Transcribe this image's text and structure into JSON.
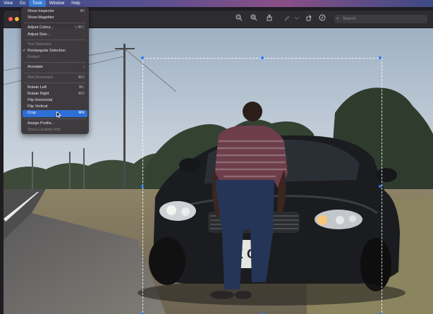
{
  "menubar": {
    "items": [
      {
        "label": "View",
        "active": false
      },
      {
        "label": "Go",
        "active": false
      },
      {
        "label": "Tools",
        "active": true
      },
      {
        "label": "Window",
        "active": false
      },
      {
        "label": "Help",
        "active": false
      }
    ]
  },
  "toolbar": {
    "search_placeholder": "Search",
    "icons": [
      "zoom-out-icon",
      "zoom-in-icon",
      "share-icon",
      "markup-icon",
      "chevron-down-icon",
      "rotate-icon",
      "markup-circle-icon"
    ]
  },
  "tools_menu": {
    "items": [
      {
        "label": "Show Inspector",
        "shortcut": "⌘I",
        "type": "item"
      },
      {
        "label": "Show Magnifier",
        "shortcut": "`",
        "type": "item"
      },
      {
        "type": "separator"
      },
      {
        "label": "Adjust Colour...",
        "shortcut": "⌥⌘C",
        "type": "item"
      },
      {
        "label": "Adjust Size...",
        "shortcut": "",
        "type": "item"
      },
      {
        "type": "separator"
      },
      {
        "label": "Text Selection",
        "shortcut": "",
        "type": "disabled"
      },
      {
        "label": "Rectangular Selection",
        "shortcut": "",
        "type": "checked"
      },
      {
        "label": "Redact",
        "shortcut": "",
        "type": "disabled"
      },
      {
        "type": "separator"
      },
      {
        "label": "Annotate",
        "shortcut": "",
        "type": "submenu"
      },
      {
        "type": "separator"
      },
      {
        "label": "Add Bookmark",
        "shortcut": "⌘D",
        "type": "disabled"
      },
      {
        "type": "separator"
      },
      {
        "label": "Rotate Left",
        "shortcut": "⌘L",
        "type": "item"
      },
      {
        "label": "Rotate Right",
        "shortcut": "⌘R",
        "type": "item"
      },
      {
        "label": "Flip Horizontal",
        "shortcut": "",
        "type": "item"
      },
      {
        "label": "Flip Vertical",
        "shortcut": "",
        "type": "item"
      },
      {
        "label": "Crop",
        "shortcut": "⌘K",
        "type": "selected"
      },
      {
        "type": "separator"
      },
      {
        "label": "Assign Profile...",
        "shortcut": "",
        "type": "item"
      },
      {
        "label": "Show Location Info",
        "shortcut": "",
        "type": "disabled"
      }
    ]
  },
  "photo": {
    "plate_text": "K  G"
  },
  "colors": {
    "accent": "#2d6fd6",
    "selection_handle": "#2a7bf3"
  }
}
